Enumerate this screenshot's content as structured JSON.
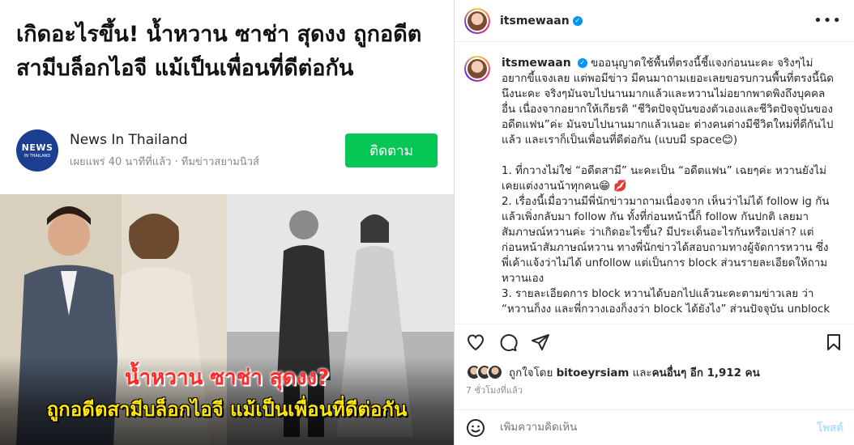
{
  "article": {
    "headline": "เกิดอะไรขึ้น! น้ำหวาน ซาช่า สุดงง ถูกอดีตสามีบล็อกไอจี แม้เป็นเพื่อนที่ดีต่อกัน",
    "logo_line1": "NEWS",
    "logo_line2": "IN THAILAND",
    "source_name": "News In Thailand",
    "source_meta": "เผยแพร่ 40 นาทีที่แล้ว · ทีมข่าวสยามนิวส์",
    "follow_label": "ติดตาม",
    "follow_color": "#06c755"
  },
  "photo": {
    "caption_line1": "น้ำหวาน ซาช่า สุดงง?",
    "caption_line2": "ถูกอดีตสามีบล็อกไอจี แม้เป็นเพื่อนที่ดีต่อกัน"
  },
  "header": {
    "username": "itsmewaan",
    "more_icon": "more-horizontal-icon"
  },
  "caption": {
    "username": "itsmewaan",
    "p1": "ขออนุญาตใช้พื้นที่ตรงนี้ชี้แจงก่อนนะคะ จริงๆไม่อยากขี้แจงเลย แต่พอมีข่าว มีคนมาถามเยอะเลยขอรบกวนพื้นที่ตรงนี้นิดนึงนะคะ จริงๆมันจบไปนานมากแล้วและหวานไม่อยากพาดพิงถึงบุคคลอื่น เนื่องจากอยากให้เกียรติ “ชีวิตปัจจุบันของตัวเองและชีวิตปัจจุบันของอดีตแฟน”ค่ะ มันจบไปนานมากแล้วเนอะ ต่างคนต่างมีชีวิตใหม่ที่ดีกันไปแล้ว และเราก็เป็นเพื่อนที่ดีต่อกัน (แบบมี space😊)",
    "p2": "1. ที่กวางไม่ใช่ “อดีตสามี” นะคะเป็น “อดีตแฟน” เฉยๆค่ะ หวานยังไม่เคยแต่งงานน้าทุกคน😁 💋",
    "p3": "2. เรื่องนี้เมื่อวานมีพี่นักข่าวมาถามเนื่องจาก เห็นว่าไม่ได้ follow ig กันแล้วเพิ่งกลับมา follow กัน ทั้งที่ก่อนหน้านี้ก็ follow กันปกติ เลยมาสัมภาษณ์หวานค่ะ ว่าเกิดอะไรขึ้น? มีประเด็นอะไรกันหรือเปล่า? แต่ก่อนหน้าสัมภาษณ์หวาน ทางพี่นักข่าวได้สอบถามทางผู้จัดการหวาน ซึ่งพี่เค้าแจ้งว่าไม่ได้ unfollow แต่เป็นการ block ส่วนรายละเอียดให้ถามหวานเอง",
    "p4": "3. รายละเอียดการ block หวานได้บอกไปแล้วนะคะตามข่าวเลย ว่า “หวานก็งง และพี่กวางเองก็งงว่า block ได้ยังไง” ส่วนปัจจุบัน unblock"
  },
  "actions": {
    "like_icon": "heart-icon",
    "comment_icon": "comment-icon",
    "share_icon": "share-icon",
    "save_icon": "bookmark-icon"
  },
  "likes": {
    "prefix": "ถูกใจโดย ",
    "first_user": "bitoeyrsiam",
    "middle": " และ",
    "others": "คนอื่นๆ อีก 1,912 คน"
  },
  "timestamp": "7 ชั่วโมงที่แล้ว",
  "comment_bar": {
    "placeholder": "เพิ่มความคิดเห็น",
    "post_label": "โพสต์",
    "emoji_icon": "emoji-icon"
  }
}
